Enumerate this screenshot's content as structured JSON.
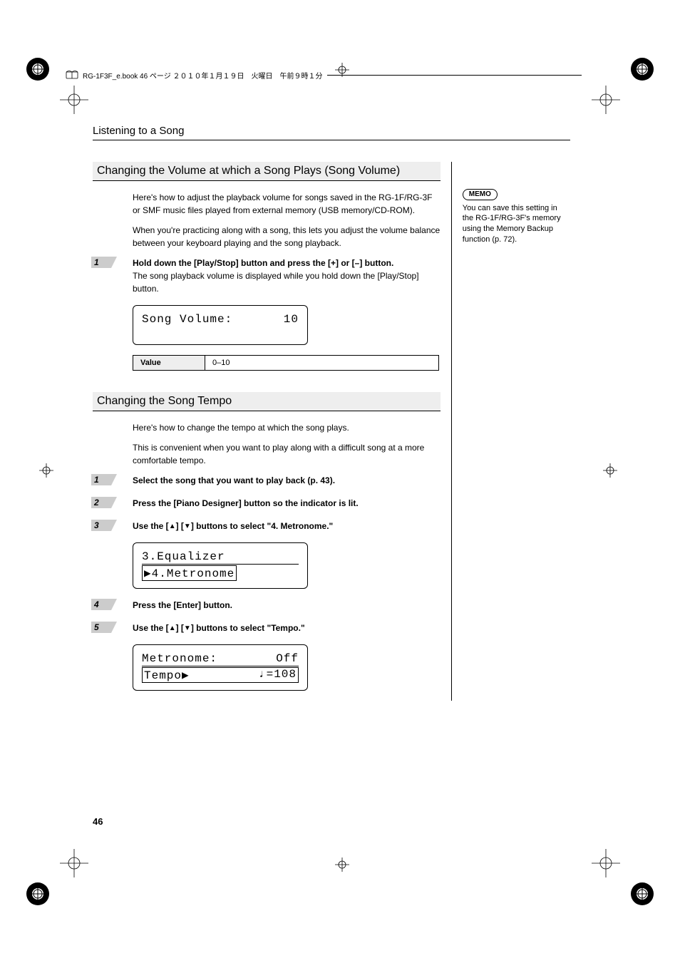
{
  "header": {
    "running": "RG-1F3F_e.book  46 ページ  ２０１０年１月１９日　火曜日　午前９時１分"
  },
  "breadcrumb": "Listening to a Song",
  "section1": {
    "title": "Changing the Volume at which a Song Plays (Song Volume)",
    "p1": "Here's how to adjust the playback volume for songs saved in the RG-1F/RG-3F or SMF music files played from external memory (USB memory/CD-ROM).",
    "p2": "When you're practicing along with a song, this lets you adjust the volume balance between your keyboard playing and the song playback.",
    "step1_bold": "Hold down the [Play/Stop] button and press the [+] or [–] button.",
    "step1_body": "The song playback volume is displayed while you hold down the [Play/Stop] button.",
    "lcd_label": "Song Volume:",
    "lcd_value": "10",
    "value_label": "Value",
    "value_range": "0–10"
  },
  "section2": {
    "title": "Changing the Song Tempo",
    "p1": "Here's how to change the tempo at which the song plays.",
    "p2": "This is convenient when you want to play along with a difficult song at a more comfortable tempo.",
    "step1": "Select the song that you want to play back (p. 43).",
    "step2": "Press the [Piano Designer] button so the indicator is lit.",
    "step3_pre": "Use the [",
    "step3_mid": "] [",
    "step3_post": "] buttons to select \"4. Metronome.\"",
    "lcd1_line1": " 3.Equalizer",
    "lcd1_line2_marker": "▶",
    "lcd1_line2": "4.Metronome",
    "step4": "Press the [Enter] button.",
    "step5_pre": "Use the [",
    "step5_mid": "] [",
    "step5_post": "] buttons to select \"Tempo.\"",
    "lcd2_line1_l": "Metronome:",
    "lcd2_line1_r": "Off",
    "lcd2_line2_l": "Tempo▶",
    "lcd2_line2_r": "♩=108"
  },
  "memo": {
    "label": "MEMO",
    "text": "You can save this setting in the RG-1F/RG-3F's memory using the Memory Backup function (p. 72)."
  },
  "steps": {
    "n1": "1",
    "n2": "2",
    "n3": "3",
    "n4": "4",
    "n5": "5"
  },
  "page_number": "46"
}
